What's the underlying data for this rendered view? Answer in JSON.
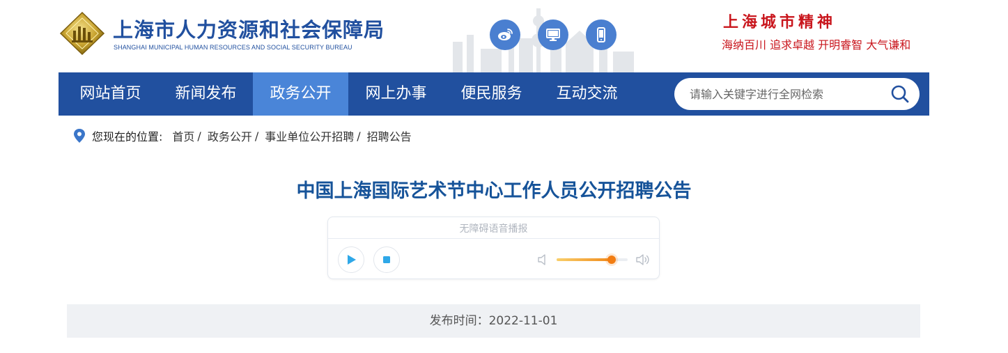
{
  "header": {
    "bureau_name": "上海市人力资源和社会保障局",
    "bureau_name_en": "SHANGHAI MUNICIPAL HUMAN RESOURCES AND SOCIAL SECURITY BUREAU",
    "social_icons": [
      "weibo-icon",
      "desktop-icon",
      "mobile-icon"
    ],
    "spirit_title": "上海城市精神",
    "spirit_words": "海纳百川  追求卓越  开明睿智  大气谦和"
  },
  "nav": {
    "items": [
      {
        "label": "网站首页",
        "active": false
      },
      {
        "label": "新闻发布",
        "active": false
      },
      {
        "label": "政务公开",
        "active": true
      },
      {
        "label": "网上办事",
        "active": false
      },
      {
        "label": "便民服务",
        "active": false
      },
      {
        "label": "互动交流",
        "active": false
      }
    ],
    "search_placeholder": "请输入关键字进行全网检索"
  },
  "breadcrumb": {
    "label": "您现在的位置:",
    "items": [
      "首页",
      "政务公开",
      "事业单位公开招聘",
      "招聘公告"
    ]
  },
  "article": {
    "title": "中国上海国际艺术节中心工作人员公开招聘公告",
    "publish_time": "发布时间：2022-11-01"
  },
  "player": {
    "label": "无障碍语音播报",
    "volume": 0.77
  },
  "colors": {
    "brand_blue": "#21509f",
    "nav_active": "#4a85d8",
    "spirit_red": "#c9161d",
    "title_blue": "#165399"
  }
}
